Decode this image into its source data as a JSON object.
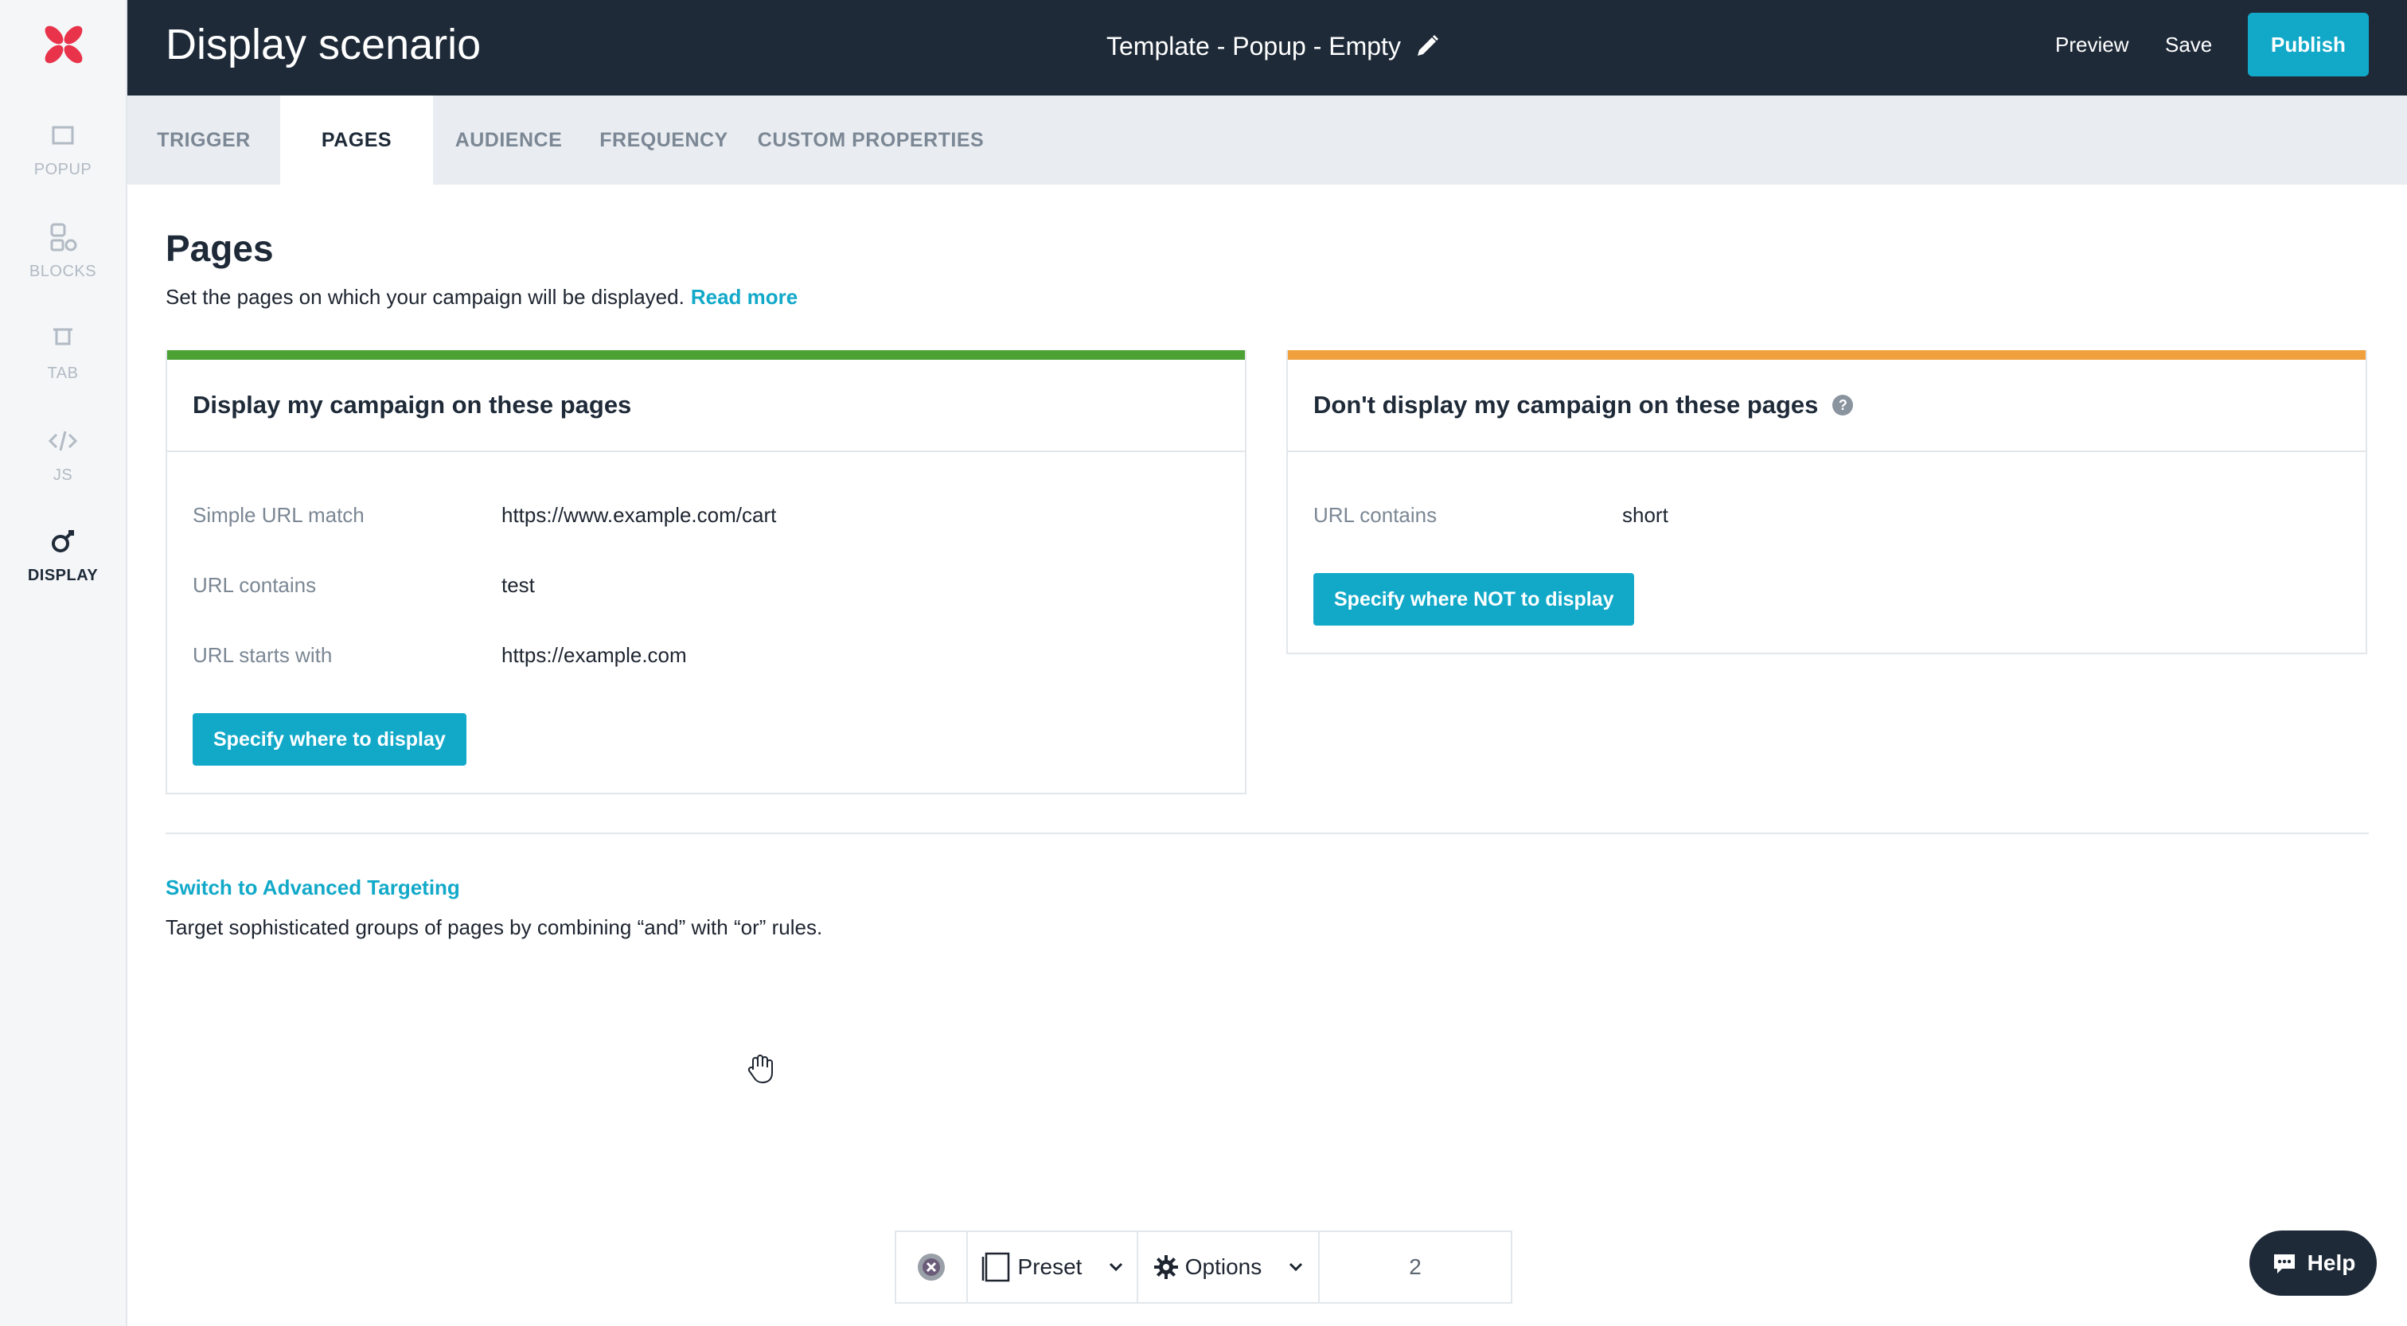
{
  "sidebar": {
    "items": [
      {
        "id": "popup",
        "label": "POPUP",
        "icon": "popup-icon"
      },
      {
        "id": "blocks",
        "label": "BLOCKS",
        "icon": "blocks-icon"
      },
      {
        "id": "tab",
        "label": "TAB",
        "icon": "tab-icon"
      },
      {
        "id": "js",
        "label": "JS",
        "icon": "code-icon"
      },
      {
        "id": "display",
        "label": "DISPLAY",
        "icon": "display-icon",
        "active": true
      }
    ]
  },
  "header": {
    "title": "Display scenario",
    "template_name": "Template - Popup - Empty",
    "preview_label": "Preview",
    "save_label": "Save",
    "publish_label": "Publish"
  },
  "tabs": [
    {
      "label": "TRIGGER"
    },
    {
      "label": "PAGES",
      "active": true
    },
    {
      "label": "AUDIENCE"
    },
    {
      "label": "FREQUENCY"
    },
    {
      "label": "CUSTOM PROPERTIES"
    }
  ],
  "pages": {
    "title": "Pages",
    "description": "Set the pages on which your campaign will be displayed.",
    "read_more": "Read more"
  },
  "display_card": {
    "title": "Display my campaign on these pages",
    "accent": "#4ca134",
    "rules": [
      {
        "type": "Simple URL match",
        "value": "https://www.example.com/cart"
      },
      {
        "type": "URL contains",
        "value": "test"
      },
      {
        "type": "URL starts with",
        "value": "https://example.com"
      }
    ],
    "button_label": "Specify where to display"
  },
  "exclude_card": {
    "title": "Don't display my campaign on these pages",
    "help_glyph": "?",
    "accent": "#f0a03c",
    "rules": [
      {
        "type": "URL contains",
        "value": "short"
      }
    ],
    "button_label": "Specify where NOT to display"
  },
  "advanced": {
    "link": "Switch to Advanced Targeting",
    "description": "Target sophisticated groups of pages by combining “and” with “or” rules."
  },
  "toolbar": {
    "preset_label": "Preset",
    "options_label": "Options",
    "count": "2"
  },
  "help": {
    "label": "Help"
  },
  "colors": {
    "accent": "#12a9c9",
    "header_bg": "#1e2a38",
    "brand_red": "#e8334a"
  }
}
